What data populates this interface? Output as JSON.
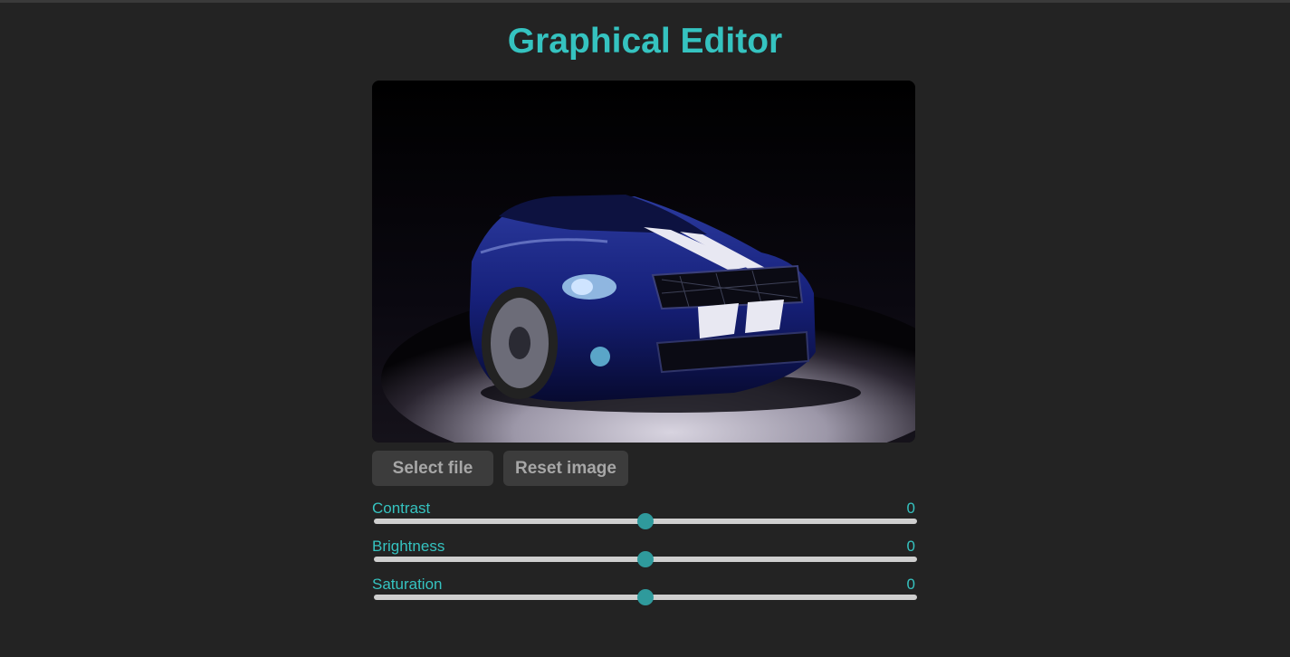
{
  "app": {
    "title": "Graphical Editor"
  },
  "image": {
    "description_icon": "car-photo"
  },
  "buttons": {
    "select_file": "Select file",
    "reset_image": "Reset image"
  },
  "sliders": [
    {
      "label": "Contrast",
      "value": "0",
      "level": 0.5
    },
    {
      "label": "Brightness",
      "value": "0",
      "level": 0.5
    },
    {
      "label": "Saturation",
      "value": "0",
      "level": 0.5
    }
  ],
  "colors": {
    "accent": "#35c3c0",
    "thumb": "#2f9a9c",
    "background": "#232323",
    "button_bg": "#3c3c3c",
    "button_text": "#a7a7a7"
  }
}
